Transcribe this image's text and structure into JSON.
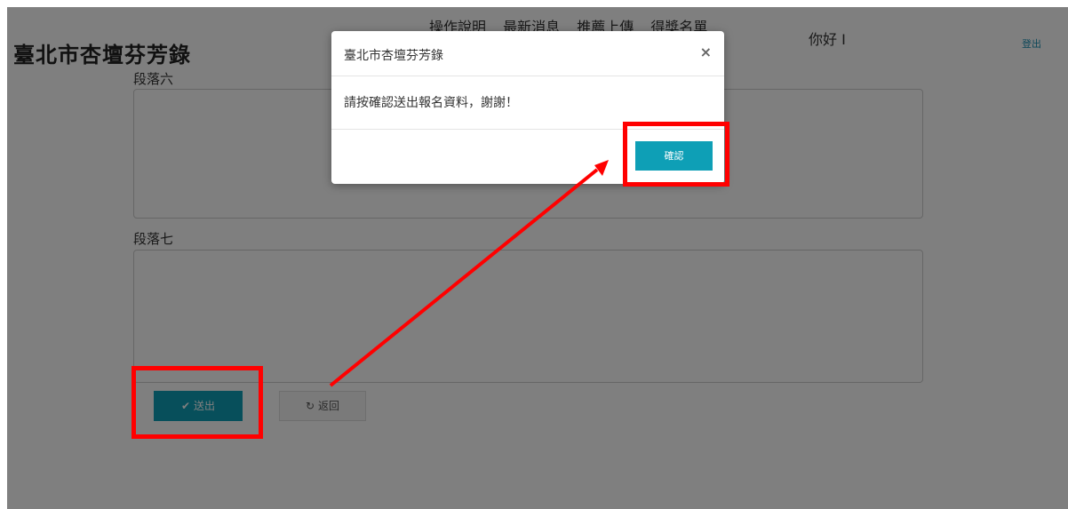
{
  "site": {
    "title": "臺北市杏壇芬芳錄"
  },
  "nav": {
    "items": [
      {
        "label": "操作說明"
      },
      {
        "label": "最新消息"
      },
      {
        "label": "推薦上傳"
      },
      {
        "label": "得獎名單"
      }
    ],
    "greeting": "你好 I",
    "logout": "登出"
  },
  "form": {
    "paragraph6_label": "段落六",
    "paragraph7_label": "段落七",
    "paragraph6_value": "",
    "paragraph7_value": ""
  },
  "buttons": {
    "submit_icon": "✔",
    "submit": "送出",
    "back_icon": "↻",
    "back": "返回"
  },
  "modal": {
    "title": "臺北市杏壇芬芳錄",
    "close": "×",
    "message": "請按確認送出報名資料，謝謝！",
    "confirm": "確認"
  },
  "colors": {
    "primary": "#0e9fb6",
    "highlight": "#ff0000",
    "overlay": "rgba(0,0,0,0.5)"
  }
}
